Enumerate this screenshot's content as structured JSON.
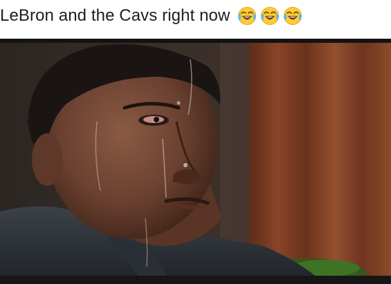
{
  "post": {
    "caption": "LeBron and the Cavs right now",
    "emojis": [
      "face-with-tears-of-joy",
      "face-with-tears-of-joy",
      "face-with-tears-of-joy"
    ]
  },
  "image": {
    "subject": "sweating-man-meme-photo"
  },
  "colors": {
    "caption_text": "#1c1e21",
    "emoji_face": "#ffcc33",
    "emoji_tears": "#5fb8ec",
    "photo_background": "#1f1a17",
    "curtain": "#7a3b22"
  }
}
